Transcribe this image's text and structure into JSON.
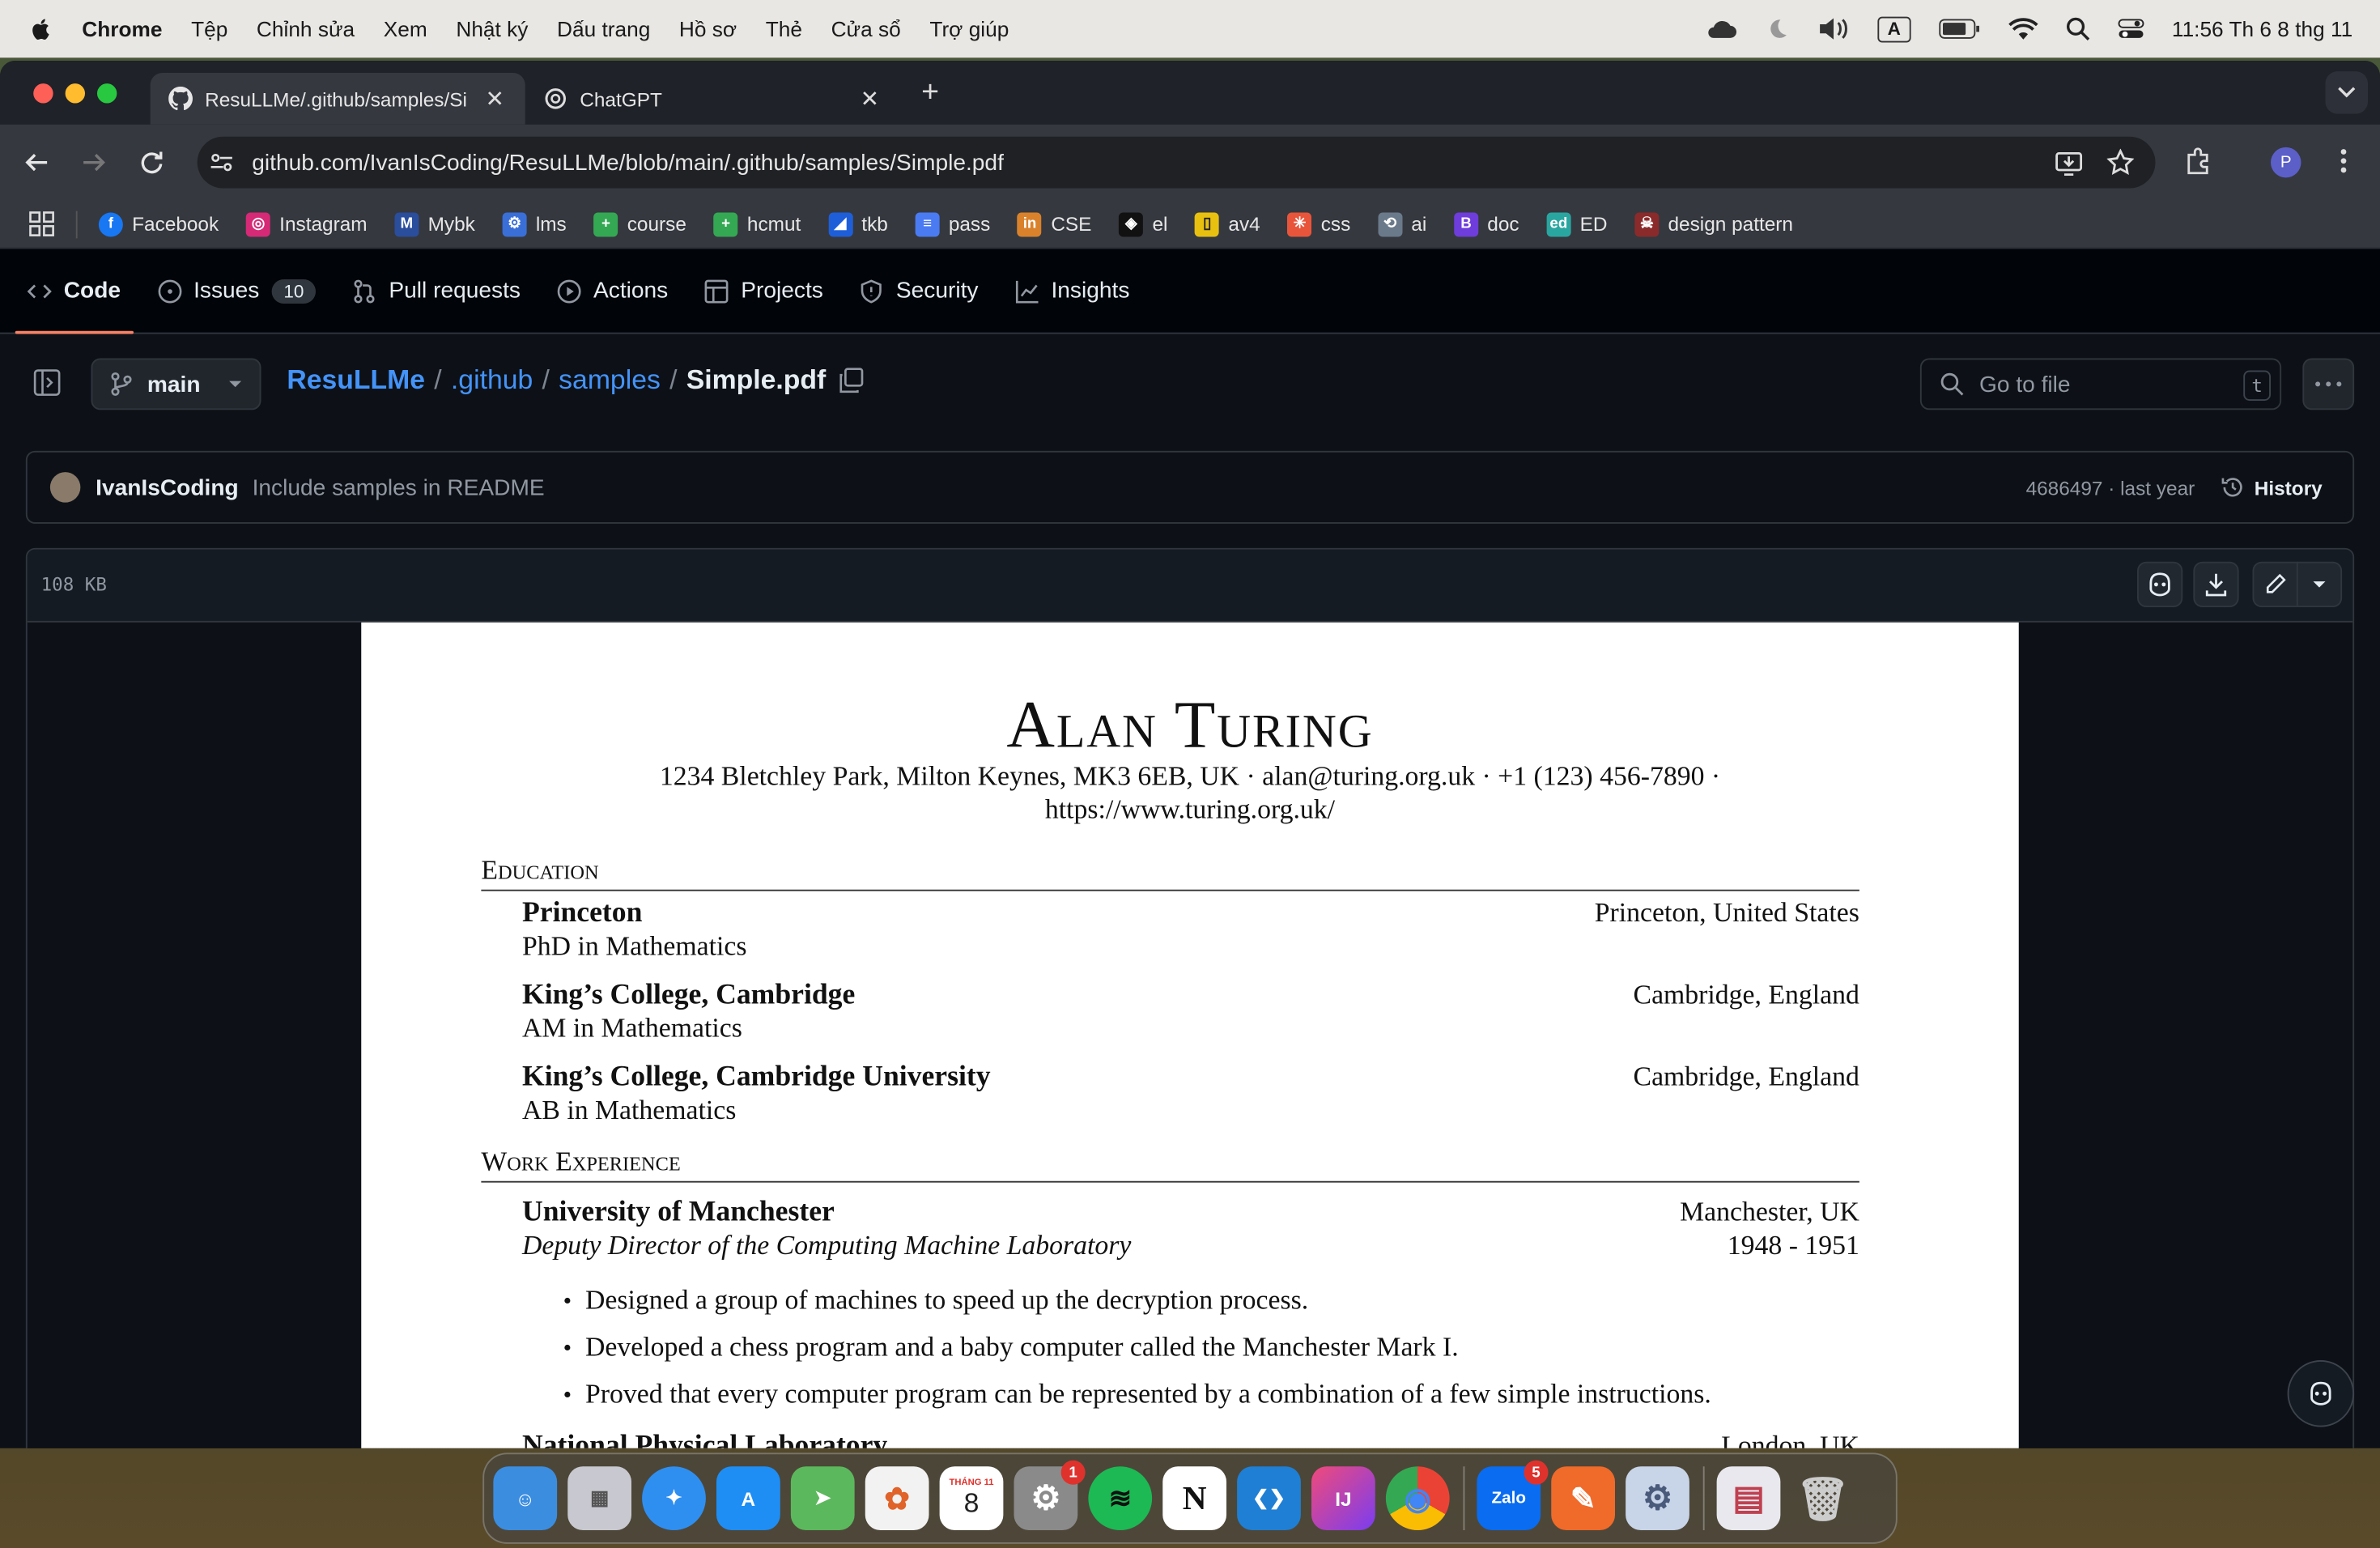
{
  "menubar": {
    "app_name": "Chrome",
    "items": [
      "Tệp",
      "Chỉnh sửa",
      "Xem",
      "Nhật ký",
      "Dấu trang",
      "Hồ sơ",
      "Thẻ",
      "Cửa sổ",
      "Trợ giúp"
    ],
    "clock": "11:56 Th 6 8 thg 11",
    "input_source": "A"
  },
  "browser": {
    "tabs": [
      {
        "title": "ResuLLMe/.github/samples/Si",
        "icon": "github-icon",
        "close": "✕"
      },
      {
        "title": "ChatGPT",
        "icon": "openai-icon",
        "close": "✕"
      }
    ],
    "new_tab": "+",
    "url": "github.com/IvanIsCoding/ResuLLMe/blob/main/.github/samples/Simple.pdf",
    "profile_initial": "P",
    "bookmarks": [
      {
        "label": "Facebook",
        "color": "#1877f2",
        "glyph": "f"
      },
      {
        "label": "Instagram",
        "color": "#d62976",
        "glyph": "◎"
      },
      {
        "label": "Mybk",
        "color": "#2a4d9c",
        "glyph": "M"
      },
      {
        "label": "lms",
        "color": "#3a6fd8",
        "glyph": "⚙"
      },
      {
        "label": "course",
        "color": "#34a853",
        "glyph": "+"
      },
      {
        "label": "hcmut",
        "color": "#34a853",
        "glyph": "+"
      },
      {
        "label": "tkb",
        "color": "#1e5fd9",
        "glyph": "◢"
      },
      {
        "label": "pass",
        "color": "#4a7bf2",
        "glyph": "≡"
      },
      {
        "label": "CSE",
        "color": "#d9822b",
        "glyph": "in"
      },
      {
        "label": "el",
        "color": "#111111",
        "glyph": "◈"
      },
      {
        "label": "av4",
        "color": "#e8c010",
        "glyph": "▯"
      },
      {
        "label": "css",
        "color": "#e8553a",
        "glyph": "✳"
      },
      {
        "label": "ai",
        "color": "#6a7a8a",
        "glyph": "⟲"
      },
      {
        "label": "doc",
        "color": "#6e3ddb",
        "glyph": "B"
      },
      {
        "label": "ED",
        "color": "#2aa6a0",
        "glyph": "ed"
      },
      {
        "label": "design pattern",
        "color": "#8a2a2a",
        "glyph": "☠"
      }
    ]
  },
  "repo_nav": [
    {
      "label": "Code",
      "icon": "code-icon",
      "selected": true
    },
    {
      "label": "Issues",
      "icon": "issue-icon",
      "count": "10"
    },
    {
      "label": "Pull requests",
      "icon": "pull-request-icon"
    },
    {
      "label": "Actions",
      "icon": "play-icon"
    },
    {
      "label": "Projects",
      "icon": "table-icon"
    },
    {
      "label": "Security",
      "icon": "shield-icon"
    },
    {
      "label": "Insights",
      "icon": "graph-icon"
    }
  ],
  "file_header": {
    "branch": "main",
    "crumbs": {
      "repo": "ResuLLMe",
      "dir1": ".github",
      "dir2": "samples",
      "file": "Simple.pdf"
    },
    "separator": "/",
    "go_to_file": "Go to file",
    "shortcut": "t"
  },
  "commit": {
    "author": "IvanIsCoding",
    "message": "Include samples in README",
    "meta": "4686497 · last year",
    "history": "History"
  },
  "viewer": {
    "size": "108 KB"
  },
  "resume": {
    "name": "Alan Turing",
    "contact1": "1234 Bletchley Park, Milton Keynes, MK3 6EB, UK · alan@turing.org.uk · +1 (123) 456-7890 ·",
    "contact2": "https://www.turing.org.uk/",
    "education_title": "Education",
    "education": [
      {
        "school": "Princeton",
        "place": "Princeton, United States",
        "degree": "PhD in Mathematics"
      },
      {
        "school": "King’s College, Cambridge",
        "place": "Cambridge, England",
        "degree": "AM in Mathematics"
      },
      {
        "school": "King’s College, Cambridge University",
        "place": "Cambridge, England",
        "degree": "AB in Mathematics"
      }
    ],
    "work_title": "Work Experience",
    "work": {
      "org": "University of Manchester",
      "place": "Manchester, UK",
      "role": "Deputy Director of the Computing Machine Laboratory",
      "dates": "1948 - 1951",
      "bullets": [
        "Designed a group of machines to speed up the decryption process.",
        "Developed a chess program and a baby computer called the Manchester Mark I.",
        "Proved that every computer program can be represented by a combination of a few simple instructions."
      ]
    },
    "next_org_partial": "National Physical Laboratory",
    "next_place_partial": "London, UK"
  },
  "dock": {
    "apps": [
      {
        "name": "finder-icon",
        "color": "#3b8de0",
        "glyph": "☺"
      },
      {
        "name": "launchpad-icon",
        "color": "#c8c8d0",
        "glyph": "▦"
      },
      {
        "name": "safari-icon",
        "color": "#2f8ff0",
        "glyph": "✦"
      },
      {
        "name": "app-store-icon",
        "color": "#1e8ef5",
        "glyph": "A"
      },
      {
        "name": "maps-icon",
        "color": "#5cb85c",
        "glyph": "➤"
      },
      {
        "name": "photos-icon",
        "color": "#f2f2f2",
        "glyph": "✿"
      },
      {
        "name": "calendar-icon",
        "color": "#ffffff",
        "glyph": "8",
        "sub": "THÁNG 11"
      },
      {
        "name": "system-settings-icon",
        "color": "#8a8a8a",
        "glyph": "⚙",
        "badge": "1"
      },
      {
        "name": "spotify-icon",
        "color": "#1db954",
        "glyph": "≋"
      },
      {
        "name": "notion-icon",
        "color": "#ffffff",
        "glyph": "N"
      },
      {
        "name": "vscode-icon",
        "color": "#1f7fd4",
        "glyph": "❮❯"
      },
      {
        "name": "intellij-icon",
        "color": "#f04a7a",
        "glyph": "IJ"
      },
      {
        "name": "chrome-icon",
        "color": "#e8e8e8",
        "glyph": "◉"
      },
      {
        "name": "zalo-icon",
        "color": "#0a6cf0",
        "glyph": "Zalo",
        "badge": "5"
      },
      {
        "name": "pen-app-icon",
        "color": "#f06a2a",
        "glyph": "✎"
      },
      {
        "name": "utility-icon",
        "color": "#c8d4e8",
        "glyph": "⚙"
      },
      {
        "name": "database-file-icon",
        "color": "#e8e8ee",
        "glyph": "▤"
      },
      {
        "name": "trash-icon",
        "color": "#b8b8b8",
        "glyph": "🗑"
      }
    ]
  }
}
